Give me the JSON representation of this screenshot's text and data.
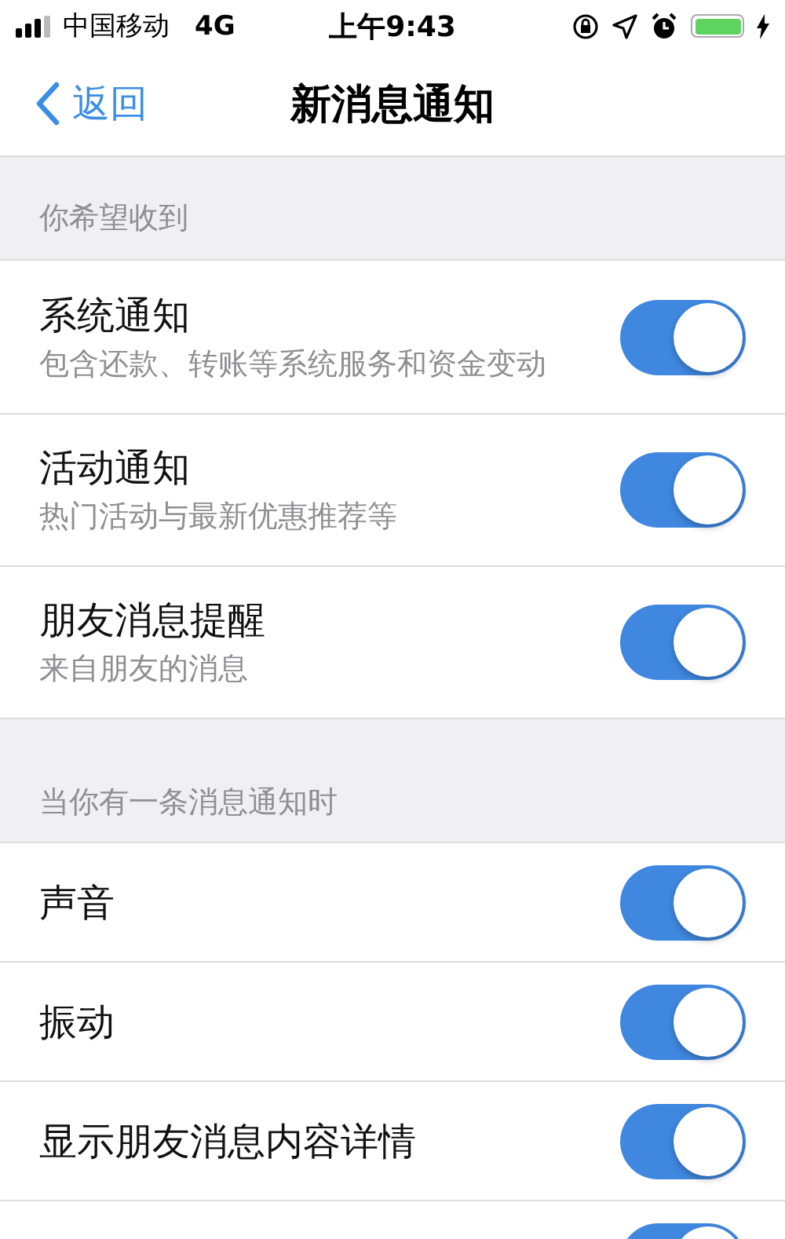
{
  "status_bar": {
    "carrier": "中国移动",
    "network": "4G",
    "time": "上午9:43"
  },
  "nav": {
    "back": "返回",
    "title": "新消息通知"
  },
  "sections": [
    {
      "header": "你希望收到",
      "items": [
        {
          "label": "系统通知",
          "subtitle": "包含还款、转账等系统服务和资金变动",
          "on": true
        },
        {
          "label": "活动通知",
          "subtitle": "热门活动与最新优惠推荐等",
          "on": true
        },
        {
          "label": "朋友消息提醒",
          "subtitle": "来自朋友的消息",
          "on": true
        }
      ]
    },
    {
      "header": "当你有一条消息通知时",
      "items": [
        {
          "label": "声音",
          "on": true
        },
        {
          "label": "振动",
          "on": true
        },
        {
          "label": "显示朋友消息内容详情",
          "on": true
        },
        {
          "on": true
        }
      ]
    }
  ]
}
